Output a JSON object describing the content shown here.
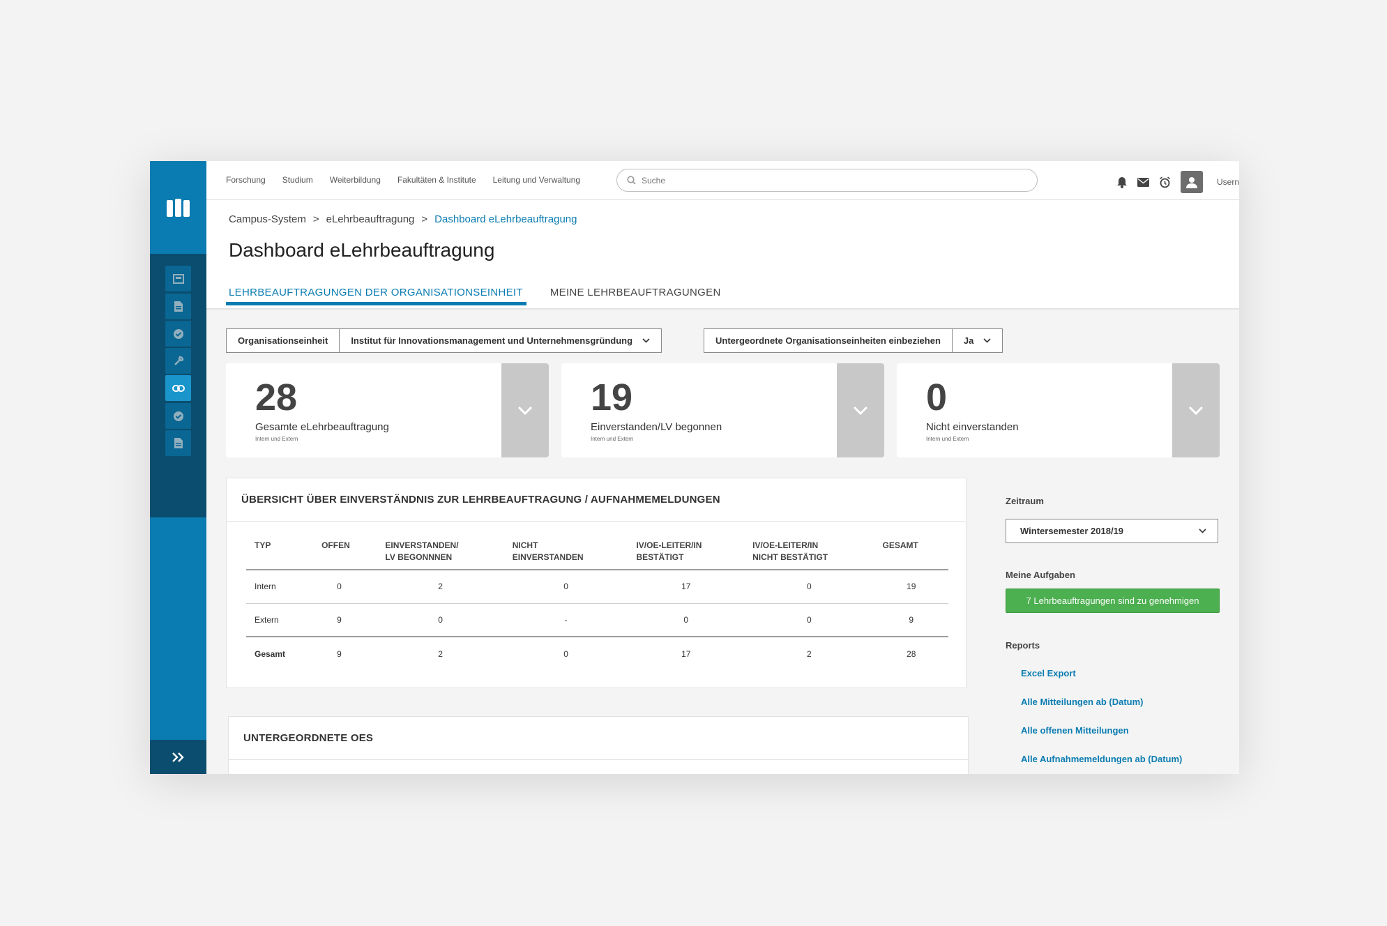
{
  "topnav": [
    "Forschung",
    "Studium",
    "Weiterbildung",
    "Fakultäten & Institute",
    "Leitung und Verwaltung"
  ],
  "search": {
    "placeholder": "Suche"
  },
  "user": {
    "name": "Username"
  },
  "breadcrumb": [
    "Campus-System",
    "eLehrbeauftragung",
    "Dashboard eLehrbeauftragung"
  ],
  "page_title": "Dashboard eLehrbeauftragung",
  "tabs": [
    "LEHRBEAUFTRAGUNGEN DER ORGANISATIONSEINHEIT",
    "MEINE LEHRBEAUFTRAGUNGEN"
  ],
  "filters": {
    "org_label": "Organisationseinheit",
    "org_value": "Institut für Innovationsmanagement und Unternehmensgründung",
    "sub_label": "Untergeordnete Organisationseinheiten einbeziehen",
    "sub_value": "Ja"
  },
  "stats": [
    {
      "value": "28",
      "label": "Gesamte eLehrbeauftragung",
      "sub": "Intern und Extern"
    },
    {
      "value": "19",
      "label": "Einverstanden/LV begonnen",
      "sub": "Intern und Extern"
    },
    {
      "value": "0",
      "label": "Nicht einverstanden",
      "sub": "Intern und Extern"
    }
  ],
  "overview": {
    "title": "ÜBERSICHT ÜBER EINVERSTÄNDNIS ZUR LEHRBEAUFTRAGUNG / AUFNAHMEMELDUNGEN",
    "columns": [
      [
        "TYP"
      ],
      [
        "OFFEN"
      ],
      [
        "EINVERSTANDEN/",
        "LV BEGONNNEN"
      ],
      [
        "NICHT",
        "EINVERSTANDEN"
      ],
      [
        "IV/OE-LEITER/IN",
        "BESTÄTIGT"
      ],
      [
        "IV/OE-LEITER/IN",
        "NICHT BESTÄTIGT"
      ],
      [
        "GESAMT"
      ]
    ],
    "rows": [
      [
        "Intern",
        "0",
        "2",
        "0",
        "17",
        "0",
        "19"
      ],
      [
        "Extern",
        "9",
        "0",
        "-",
        "0",
        "0",
        "9"
      ],
      [
        "Gesamt",
        "9",
        "2",
        "0",
        "17",
        "2",
        "28"
      ]
    ]
  },
  "sub_oes": {
    "title": "UNTERGEORDNETE OES"
  },
  "sidebar_right": {
    "zeitraum_label": "Zeitraum",
    "zeitraum_value": "Wintersemester 2018/19",
    "tasks_label": "Meine Aufgaben",
    "tasks_button": "7 Lehrbeauftragungen sind zu genehmigen",
    "reports_label": "Reports",
    "reports": [
      "Excel Export",
      "Alle Mitteilungen ab (Datum)",
      "Alle offenen Mitteilungen",
      "Alle Aufnahmemeldungen ab (Datum)"
    ]
  },
  "colors": {
    "primary": "#0a7cb1",
    "sidebar_dark": "#0b4d6e",
    "success": "#4caf50"
  },
  "icons": [
    "logo-icon",
    "search-icon",
    "bell-icon",
    "mail-icon",
    "alarm-icon",
    "user-icon",
    "logout-icon",
    "chevron-down-icon",
    "expand-icon"
  ]
}
